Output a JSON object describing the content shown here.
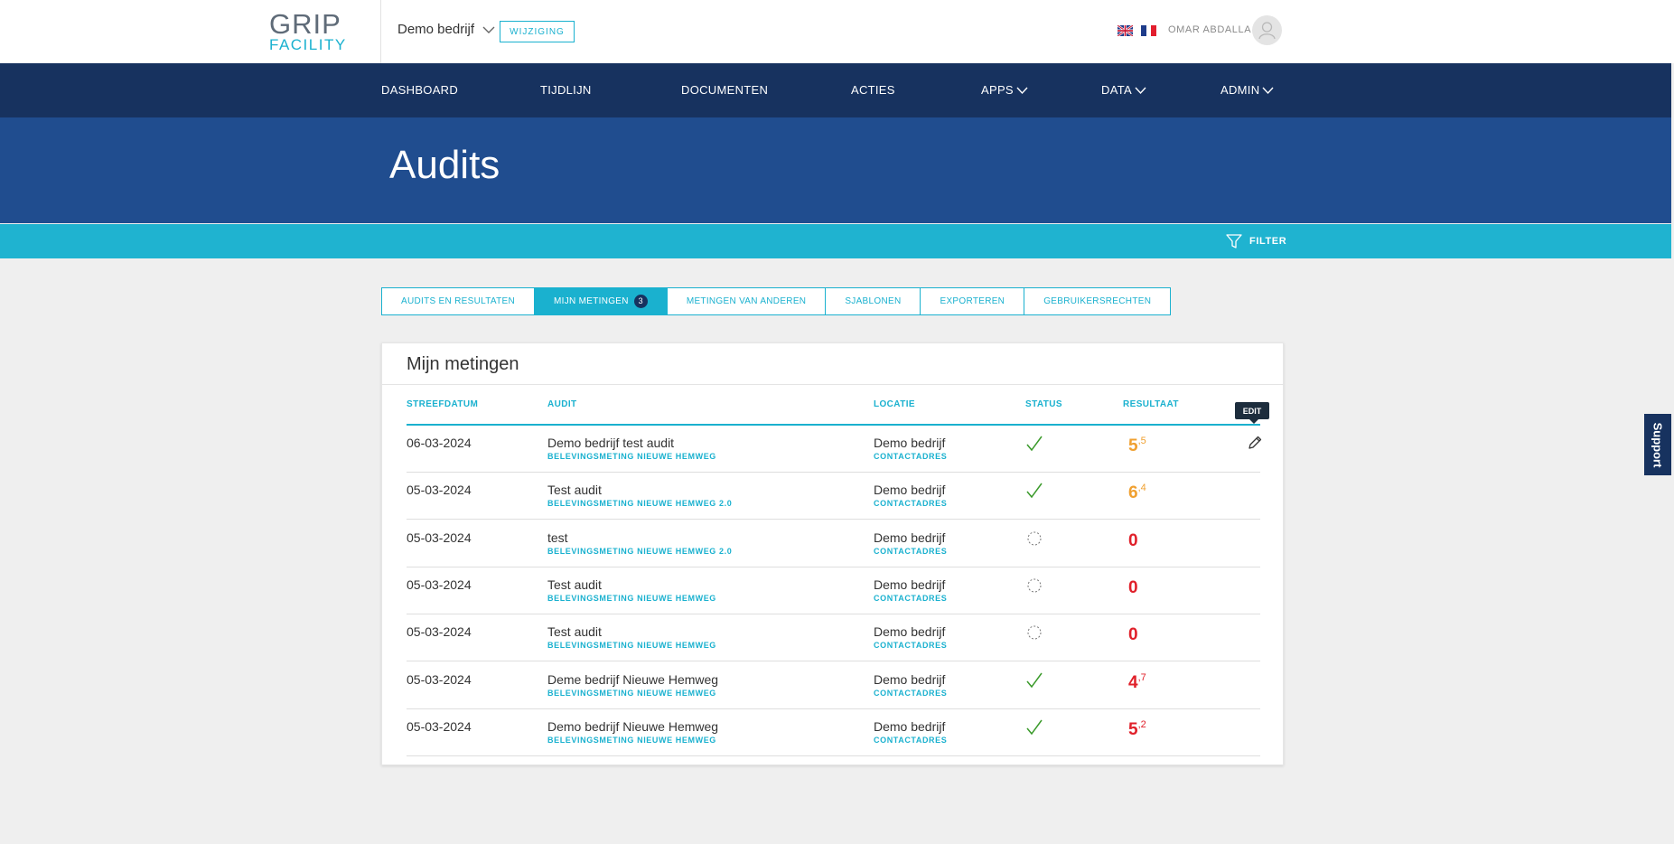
{
  "brand": {
    "logo_line1": "GRIP",
    "logo_line2": "FACILITY"
  },
  "topbar": {
    "company": "Demo bedrijf",
    "change_button": "WIJZIGING",
    "user_name": "OMAR ABDALLA"
  },
  "nav": {
    "items": [
      "DASHBOARD",
      "TIJDLIJN",
      "DOCUMENTEN",
      "ACTIES",
      "APPS",
      "DATA",
      "ADMIN"
    ]
  },
  "header": {
    "title": "Audits",
    "filter_label": "FILTER"
  },
  "tabs": [
    {
      "label": "AUDITS EN RESULTATEN"
    },
    {
      "label": "MIJN METINGEN",
      "badge": "3"
    },
    {
      "label": "METINGEN VAN ANDEREN"
    },
    {
      "label": "SJABLONEN"
    },
    {
      "label": "EXPORTEREN"
    },
    {
      "label": "GEBRUIKERSRECHTEN"
    }
  ],
  "card": {
    "title": "Mijn metingen",
    "columns": [
      "STREEFDATUM",
      "AUDIT",
      "LOCATIE",
      "STATUS",
      "RESULTAAT"
    ],
    "tooltip": "EDIT",
    "rows": [
      {
        "date": "06-03-2024",
        "audit": "Demo bedrijf test audit",
        "template": "BELEVINGSMETING NIEUWE HEMWEG",
        "location": "Demo bedrijf",
        "address": "CONTACTADRES",
        "status": "done",
        "score_int": "5",
        "score_dec": ",5",
        "score_color": "#f0a030"
      },
      {
        "date": "05-03-2024",
        "audit": "Test audit",
        "template": "BELEVINGSMETING NIEUWE HEMWEG 2.0",
        "location": "Demo bedrijf",
        "address": "CONTACTADRES",
        "status": "done",
        "score_int": "6",
        "score_dec": ",4",
        "score_color": "#f0a030"
      },
      {
        "date": "05-03-2024",
        "audit": "test",
        "template": "BELEVINGSMETING NIEUWE HEMWEG 2.0",
        "location": "Demo bedrijf",
        "address": "CONTACTADRES",
        "status": "pending",
        "score_int": "0",
        "score_dec": "",
        "score_color": "#e0202a"
      },
      {
        "date": "05-03-2024",
        "audit": "Test audit",
        "template": "BELEVINGSMETING NIEUWE HEMWEG",
        "location": "Demo bedrijf",
        "address": "CONTACTADRES",
        "status": "pending",
        "score_int": "0",
        "score_dec": "",
        "score_color": "#e0202a"
      },
      {
        "date": "05-03-2024",
        "audit": "Test audit",
        "template": "BELEVINGSMETING NIEUWE HEMWEG",
        "location": "Demo bedrijf",
        "address": "CONTACTADRES",
        "status": "pending",
        "score_int": "0",
        "score_dec": "",
        "score_color": "#e0202a"
      },
      {
        "date": "05-03-2024",
        "audit": "Deme bedrijf Nieuwe Hemweg",
        "template": "BELEVINGSMETING NIEUWE HEMWEG",
        "location": "Demo bedrijf",
        "address": "CONTACTADRES",
        "status": "done",
        "score_int": "4",
        "score_dec": ",7",
        "score_color": "#e0202a"
      },
      {
        "date": "05-03-2024",
        "audit": "Demo bedrijf Nieuwe Hemweg",
        "template": "BELEVINGSMETING NIEUWE HEMWEG",
        "location": "Demo bedrijf",
        "address": "CONTACTADRES",
        "status": "done",
        "score_int": "5",
        "score_dec": ",2",
        "score_color": "#e0202a"
      }
    ]
  },
  "support_label": "Support",
  "colors": {
    "accent": "#1ab1cf",
    "nav": "#17325f",
    "header": "#204d8f",
    "check": "#3a9a2a"
  }
}
